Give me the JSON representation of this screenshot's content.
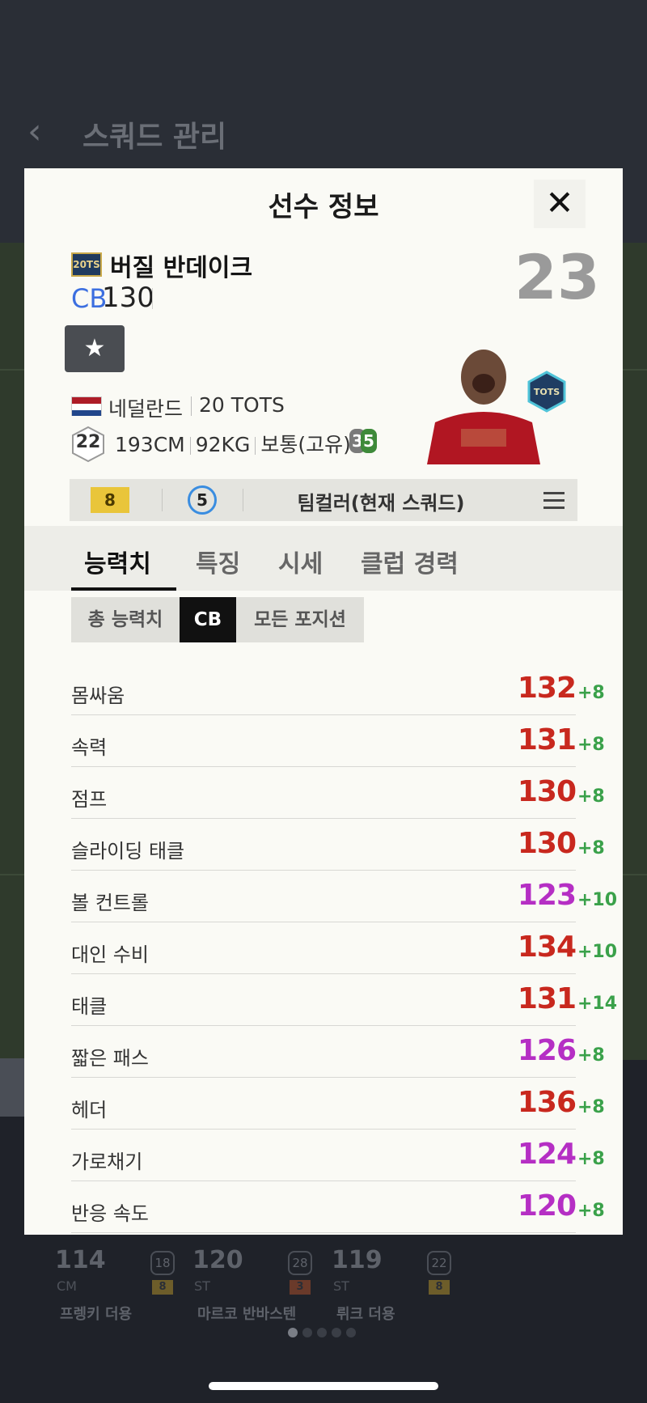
{
  "background": {
    "back_icon": "chevron-left-icon",
    "title": "스쿼드 관리",
    "cards": [
      {
        "ovr": "114",
        "pos": "CM",
        "badge": "18",
        "level": "8",
        "name": "프렝키 더용"
      },
      {
        "ovr": "120",
        "pos": "ST",
        "badge": "28",
        "level": "3",
        "name": "마르코 반바스텐"
      },
      {
        "ovr": "119",
        "pos": "ST",
        "badge": "22",
        "level": "8",
        "name": "뤼크 더용"
      }
    ]
  },
  "modal": {
    "title": "선수 정보",
    "close_icon": "close-icon",
    "season_badge": "20TS",
    "player_name": "버질 반데이크",
    "position": "CB",
    "ovr": "130",
    "big_number": "23",
    "favorite_icon": "star-icon",
    "nation": "네덜란드",
    "season": "20 TOTS",
    "age": "22",
    "height": "193CM",
    "weight": "92KG",
    "build": "보통(고유)",
    "skill_a": "3",
    "skill_b": "5",
    "tots_badge": "TOTS",
    "level": "8",
    "enhance": "5",
    "team_color": "팀컬러(현재 스쿼드)",
    "menu_icon": "hamburger-menu-icon"
  },
  "tabs": [
    {
      "label": "능력치"
    },
    {
      "label": "특징"
    },
    {
      "label": "시세"
    },
    {
      "label": "클럽 경력"
    }
  ],
  "segments": [
    "총 능력치",
    "CB",
    "모든 포지션"
  ],
  "stats": [
    {
      "label": "몸싸움",
      "value": "132",
      "bonus": "+8",
      "color": "#c8281e"
    },
    {
      "label": "속력",
      "value": "131",
      "bonus": "+8",
      "color": "#c8281e"
    },
    {
      "label": "점프",
      "value": "130",
      "bonus": "+8",
      "color": "#c8281e"
    },
    {
      "label": "슬라이딩 태클",
      "value": "130",
      "bonus": "+8",
      "color": "#c8281e"
    },
    {
      "label": "볼 컨트롤",
      "value": "123",
      "bonus": "+10",
      "color": "#b52fc4"
    },
    {
      "label": "대인 수비",
      "value": "134",
      "bonus": "+10",
      "color": "#c8281e"
    },
    {
      "label": "태클",
      "value": "131",
      "bonus": "+14",
      "color": "#c8281e"
    },
    {
      "label": "짧은 패스",
      "value": "126",
      "bonus": "+8",
      "color": "#b52fc4"
    },
    {
      "label": "헤더",
      "value": "136",
      "bonus": "+8",
      "color": "#c8281e"
    },
    {
      "label": "가로채기",
      "value": "124",
      "bonus": "+8",
      "color": "#b52fc4"
    },
    {
      "label": "반응 속도",
      "value": "120",
      "bonus": "+8",
      "color": "#b52fc4"
    }
  ]
}
